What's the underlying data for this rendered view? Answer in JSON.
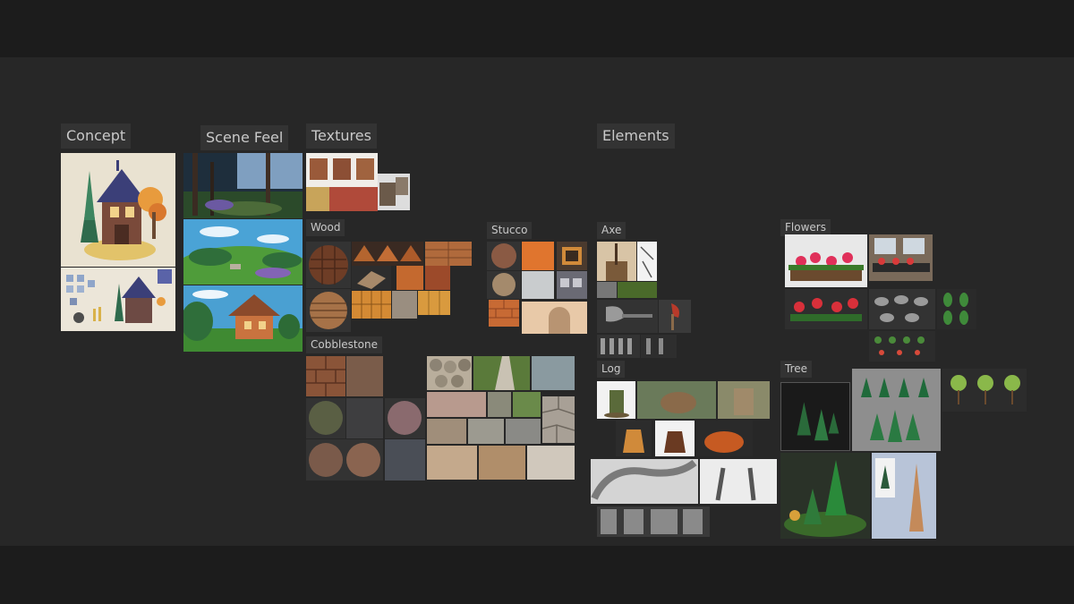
{
  "labels": {
    "concept": "Concept",
    "scene_feel": "Scene Feel",
    "textures": "Textures",
    "elements": "Elements",
    "wood": "Wood",
    "stucco": "Stucco",
    "cobblestone": "Cobblestone",
    "axe": "Axe",
    "log": "Log",
    "flowers": "Flowers",
    "tree": "Tree"
  }
}
